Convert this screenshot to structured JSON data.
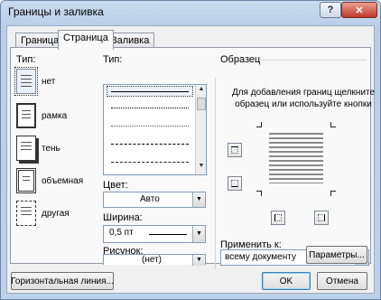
{
  "window": {
    "title": "Границы и заливка",
    "help": "?",
    "close": "✕"
  },
  "tabs": [
    {
      "label": "Граница"
    },
    {
      "label": "Страница"
    },
    {
      "label": "Заливка"
    }
  ],
  "left": {
    "type_label": "Тип:",
    "settings": [
      {
        "label": "нет"
      },
      {
        "label": "рамка"
      },
      {
        "label": "тень"
      },
      {
        "label": "объемная"
      },
      {
        "label": "другая"
      }
    ]
  },
  "middle": {
    "type_label": "Тип:",
    "color_label": "Цвет:",
    "color_value": "Авто",
    "width_label": "Ширина:",
    "width_value": "0,5 пт",
    "picture_label": "Рисунок:",
    "picture_value": "(нет)"
  },
  "right": {
    "section_label": "Образец",
    "hint": "Для добавления границ щелкните образец или используйте кнопки",
    "apply_label": "Применить к:",
    "apply_value": "всему документу",
    "params_button": "Параметры..."
  },
  "footer": {
    "hline_button": "Горизонтальная линия...",
    "ok": "OK",
    "cancel": "Отмена"
  }
}
